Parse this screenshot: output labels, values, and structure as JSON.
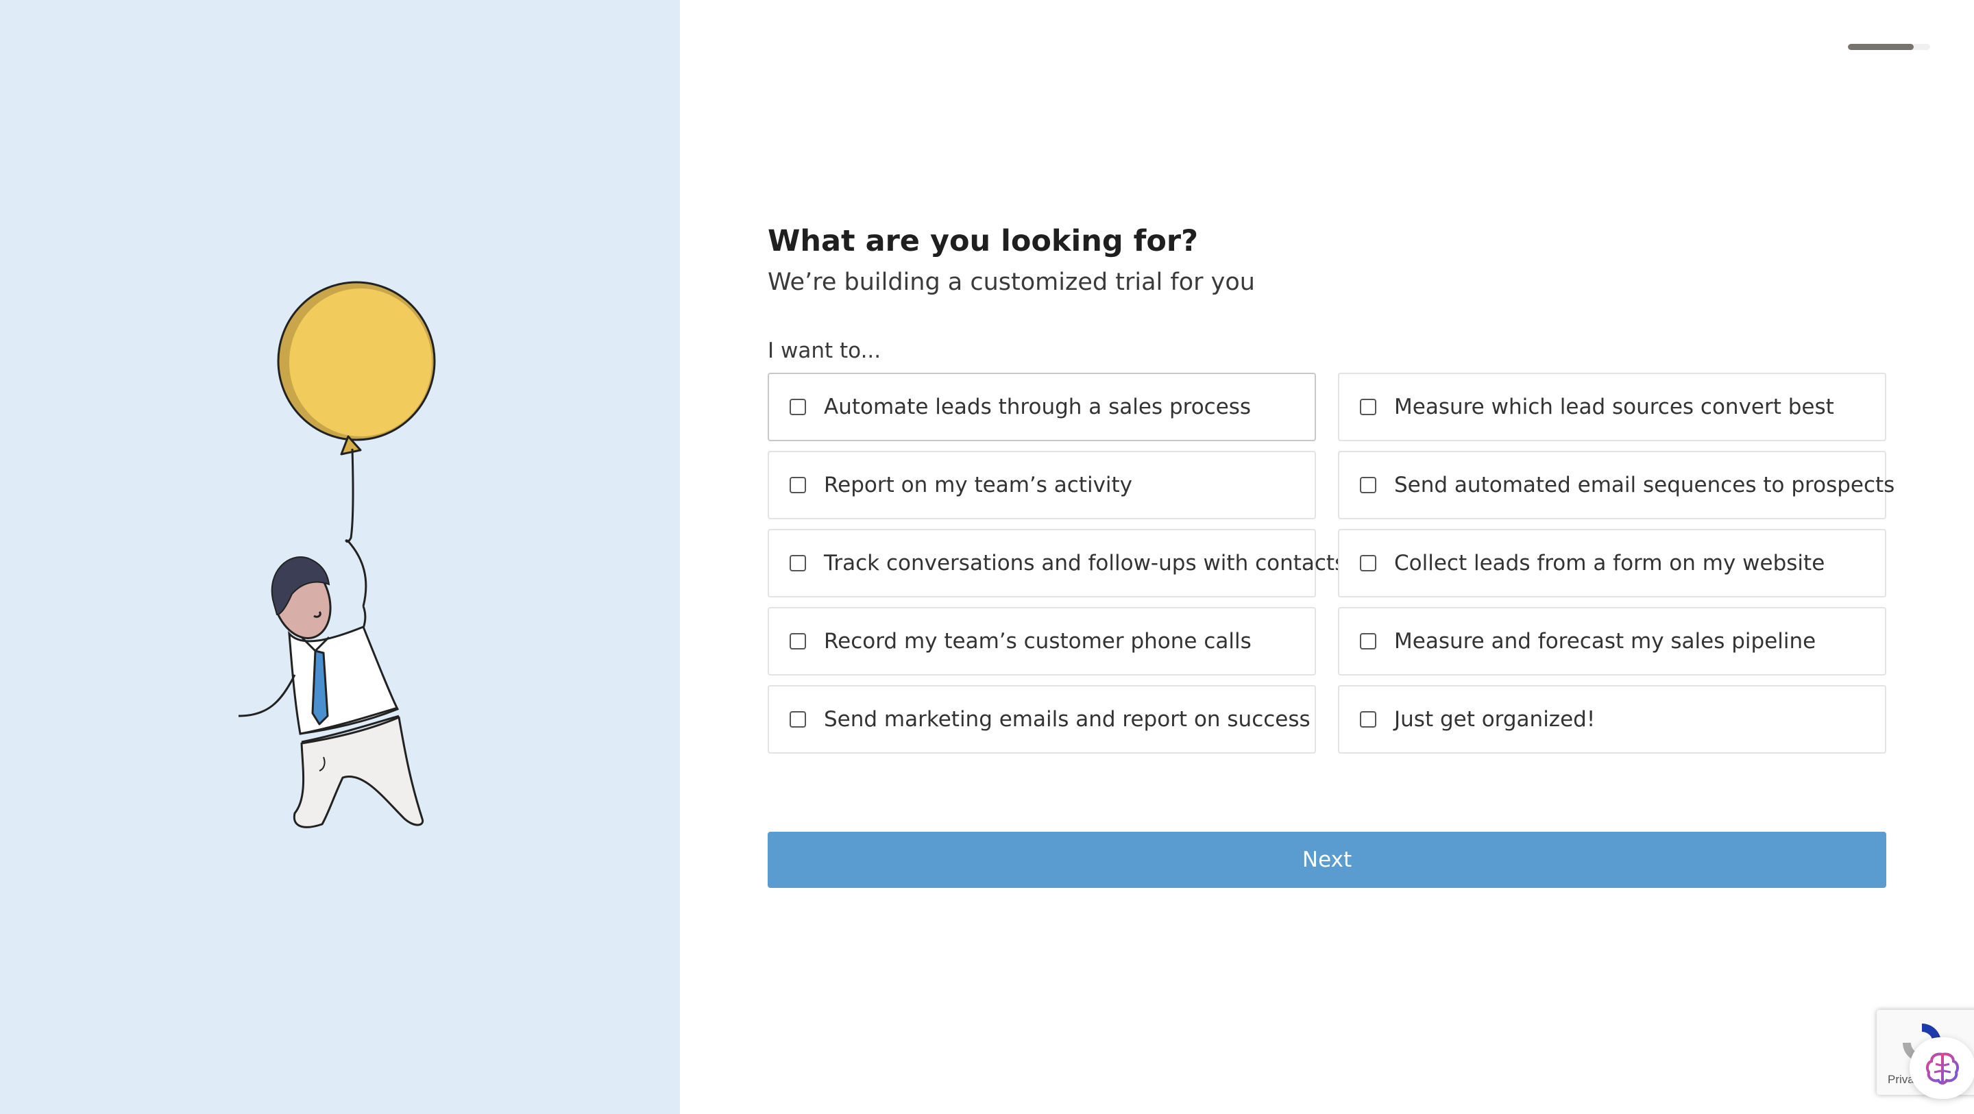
{
  "header": {
    "progress_fraction": 0.8
  },
  "form": {
    "title": "What are you looking for?",
    "subtitle": "We’re building a customized trial for you",
    "section_label": "I want to...",
    "options": [
      {
        "label": "Automate leads through a sales process",
        "checked": false
      },
      {
        "label": "Measure which lead sources convert best",
        "checked": false
      },
      {
        "label": "Report on my team’s activity",
        "checked": false
      },
      {
        "label": "Send automated email sequences to prospects",
        "checked": false
      },
      {
        "label": "Track conversations and follow-ups with contacts",
        "checked": false
      },
      {
        "label": "Collect leads from a form on my website",
        "checked": false
      },
      {
        "label": "Record my team’s customer phone calls",
        "checked": false
      },
      {
        "label": "Measure and forecast my sales pipeline",
        "checked": false
      },
      {
        "label": "Send marketing emails and report on success",
        "checked": false
      },
      {
        "label": "Just get organized!",
        "checked": false
      }
    ],
    "next_label": "Next"
  },
  "recaptcha": {
    "text": "Priva",
    "icon": "recaptcha-icon"
  },
  "assistant": {
    "icon": "brain-icon"
  },
  "colors": {
    "left_panel": "#dfecf7",
    "button": "#5a9bd0",
    "balloon": "#f2cb5d",
    "tie": "#4a8fcf"
  }
}
